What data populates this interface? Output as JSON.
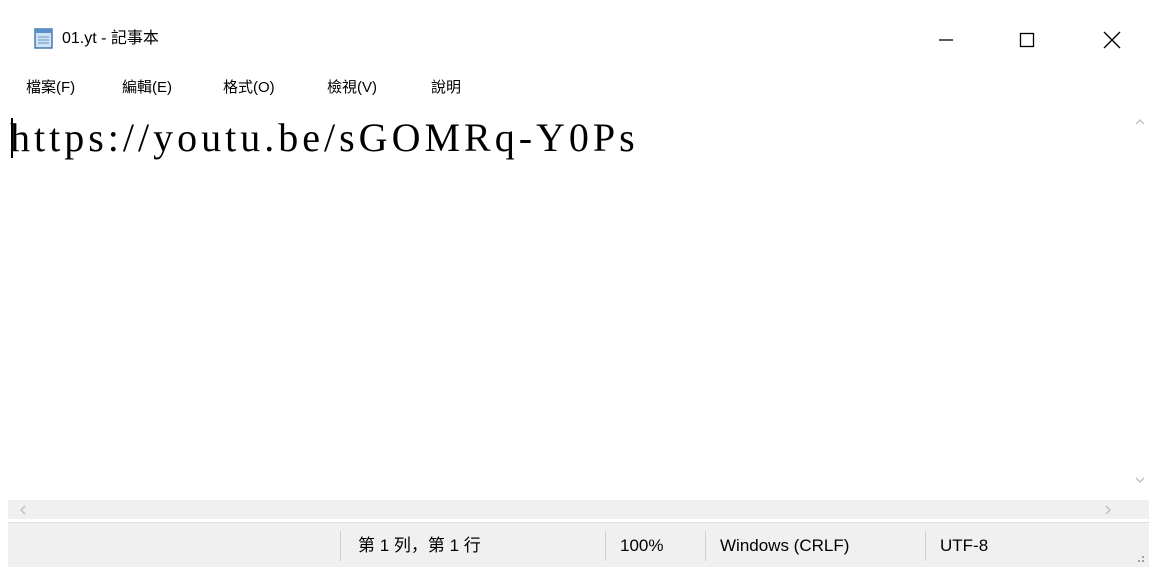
{
  "window": {
    "title": "01.yt - 記事本",
    "icon": "notepad-icon"
  },
  "menu": {
    "items": [
      {
        "label": "檔案(F)"
      },
      {
        "label": "編輯(E)"
      },
      {
        "label": "格式(O)"
      },
      {
        "label": "檢視(V)"
      },
      {
        "label": "說明"
      }
    ]
  },
  "editor": {
    "content": "https://youtu.be/sGOMRq-Y0Ps"
  },
  "status": {
    "position": "第 1 列，第 1 行",
    "zoom": "100%",
    "line_ending": "Windows (CRLF)",
    "encoding": "UTF-8"
  },
  "controls": {
    "minimize_icon": "minimize-icon",
    "maximize_icon": "maximize-icon",
    "close_icon": "close-icon"
  }
}
